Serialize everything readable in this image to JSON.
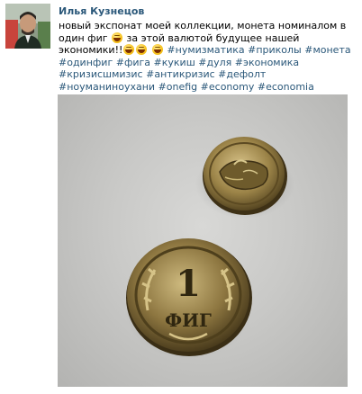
{
  "post": {
    "author_name": "Илья Кузнецов",
    "text_main": "новый экспонат моей коллекции, монета номиналом в один фиг",
    "text_after_emoji": " за этой валютой будущее нашей экономики!!",
    "hashtags": [
      "#нумизматика",
      "#приколы",
      "#монета",
      "#одинфиг",
      "#фига",
      "#кукиш",
      "#дуля",
      "#экономика",
      "#кризисшмизис",
      "#антикризис",
      "#дефолт",
      "#ноуманиноухани",
      "#onefig",
      "#economy",
      "#economia"
    ],
    "emojis": [
      "laughing-emoji",
      "grinning-emoji",
      "grinning-emoji",
      "grinning-emoji"
    ],
    "coin_inscription_value": "1",
    "coin_inscription_word": "ФИГ"
  }
}
